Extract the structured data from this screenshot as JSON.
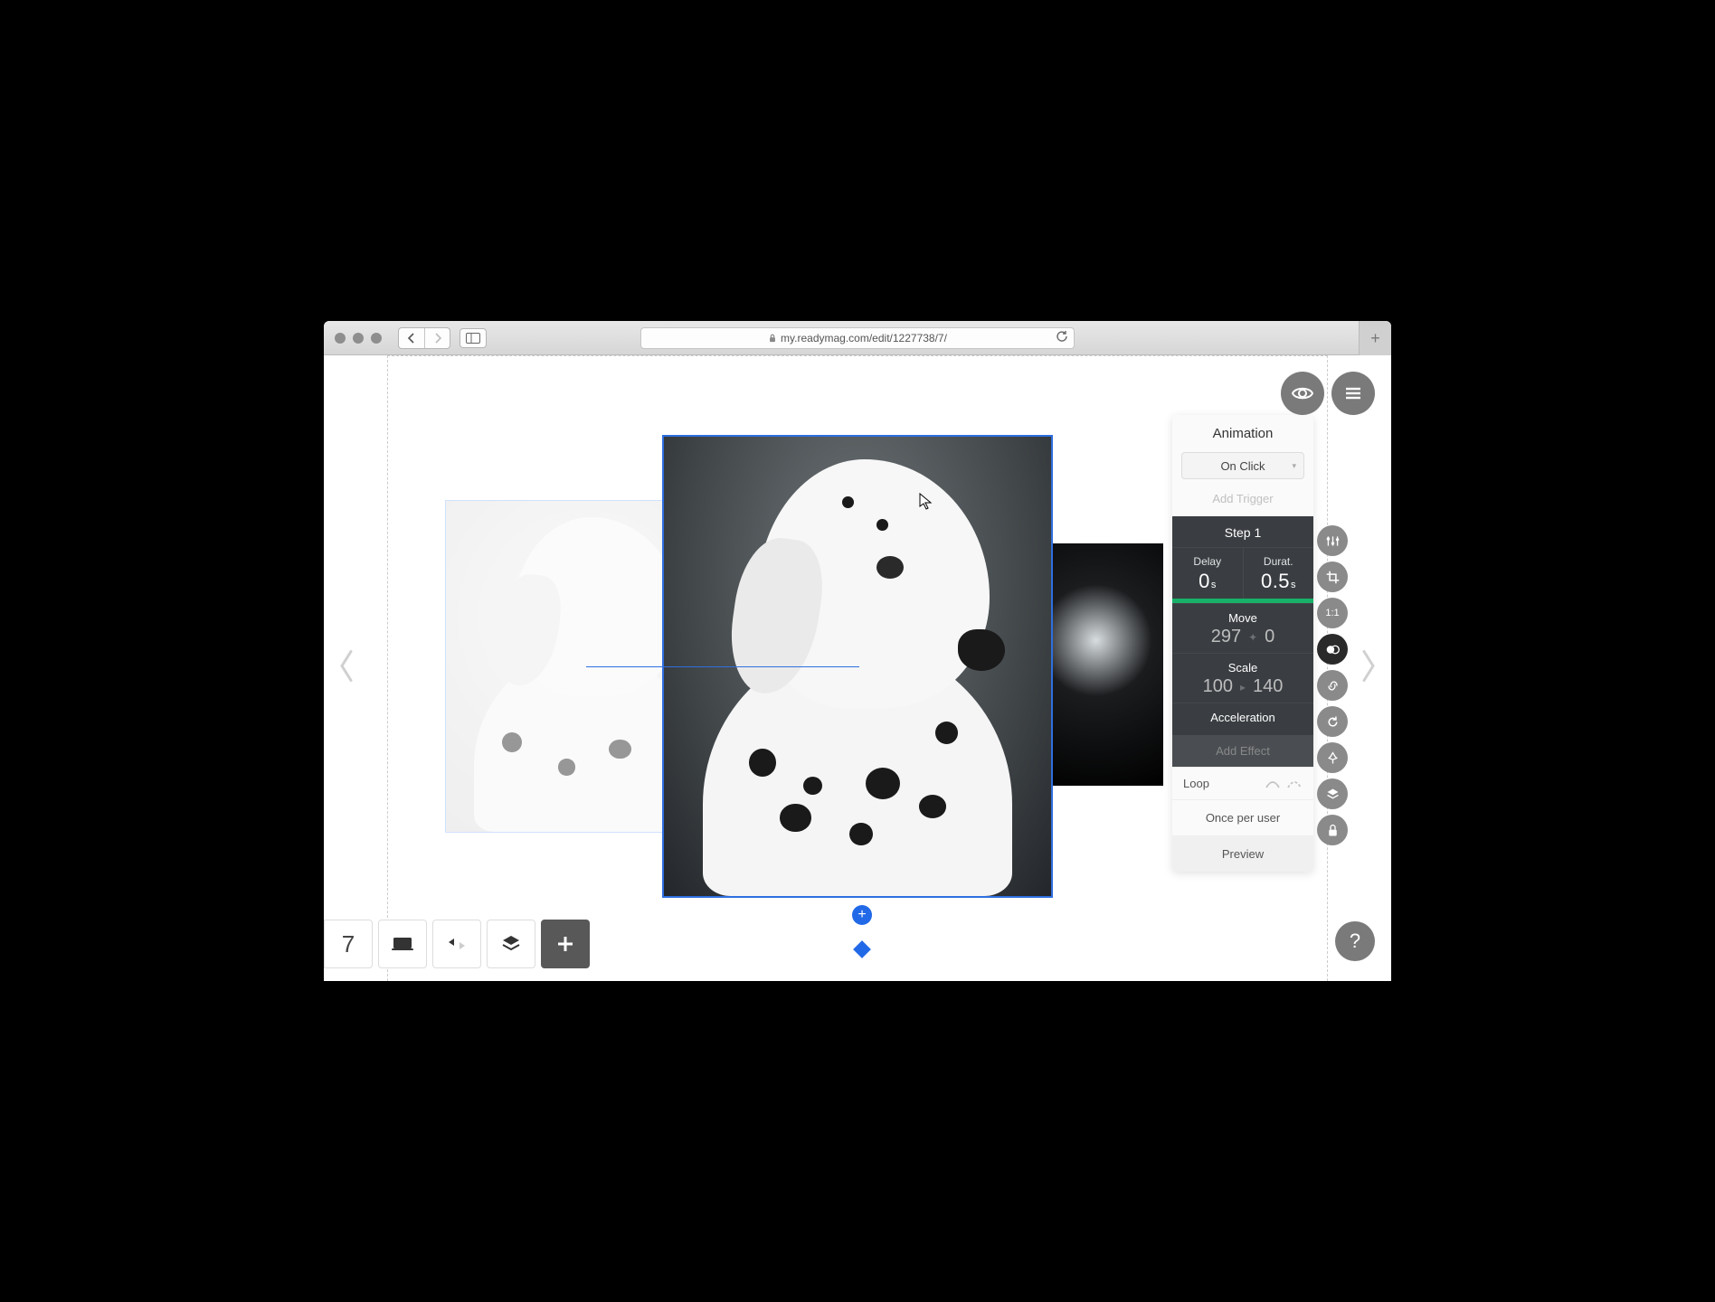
{
  "browser": {
    "url": "my.readymag.com/edit/1227738/7/"
  },
  "editor": {
    "page_number": "7"
  },
  "animation_panel": {
    "title": "Animation",
    "trigger_selected": "On Click",
    "add_trigger_label": "Add Trigger",
    "step": {
      "title": "Step 1",
      "delay_label": "Delay",
      "delay_value": "0",
      "delay_unit": "s",
      "duration_label": "Durat.",
      "duration_value": "0.5",
      "duration_unit": "s"
    },
    "move": {
      "label": "Move",
      "x": "297",
      "y": "0"
    },
    "scale": {
      "label": "Scale",
      "from": "100",
      "to": "140"
    },
    "acceleration_label": "Acceleration",
    "add_effect_label": "Add Effect",
    "loop_label": "Loop",
    "once_per_user_label": "Once per user",
    "preview_label": "Preview"
  },
  "side_tools": {
    "ratio_label": "1:1"
  },
  "help": {
    "label": "?"
  }
}
